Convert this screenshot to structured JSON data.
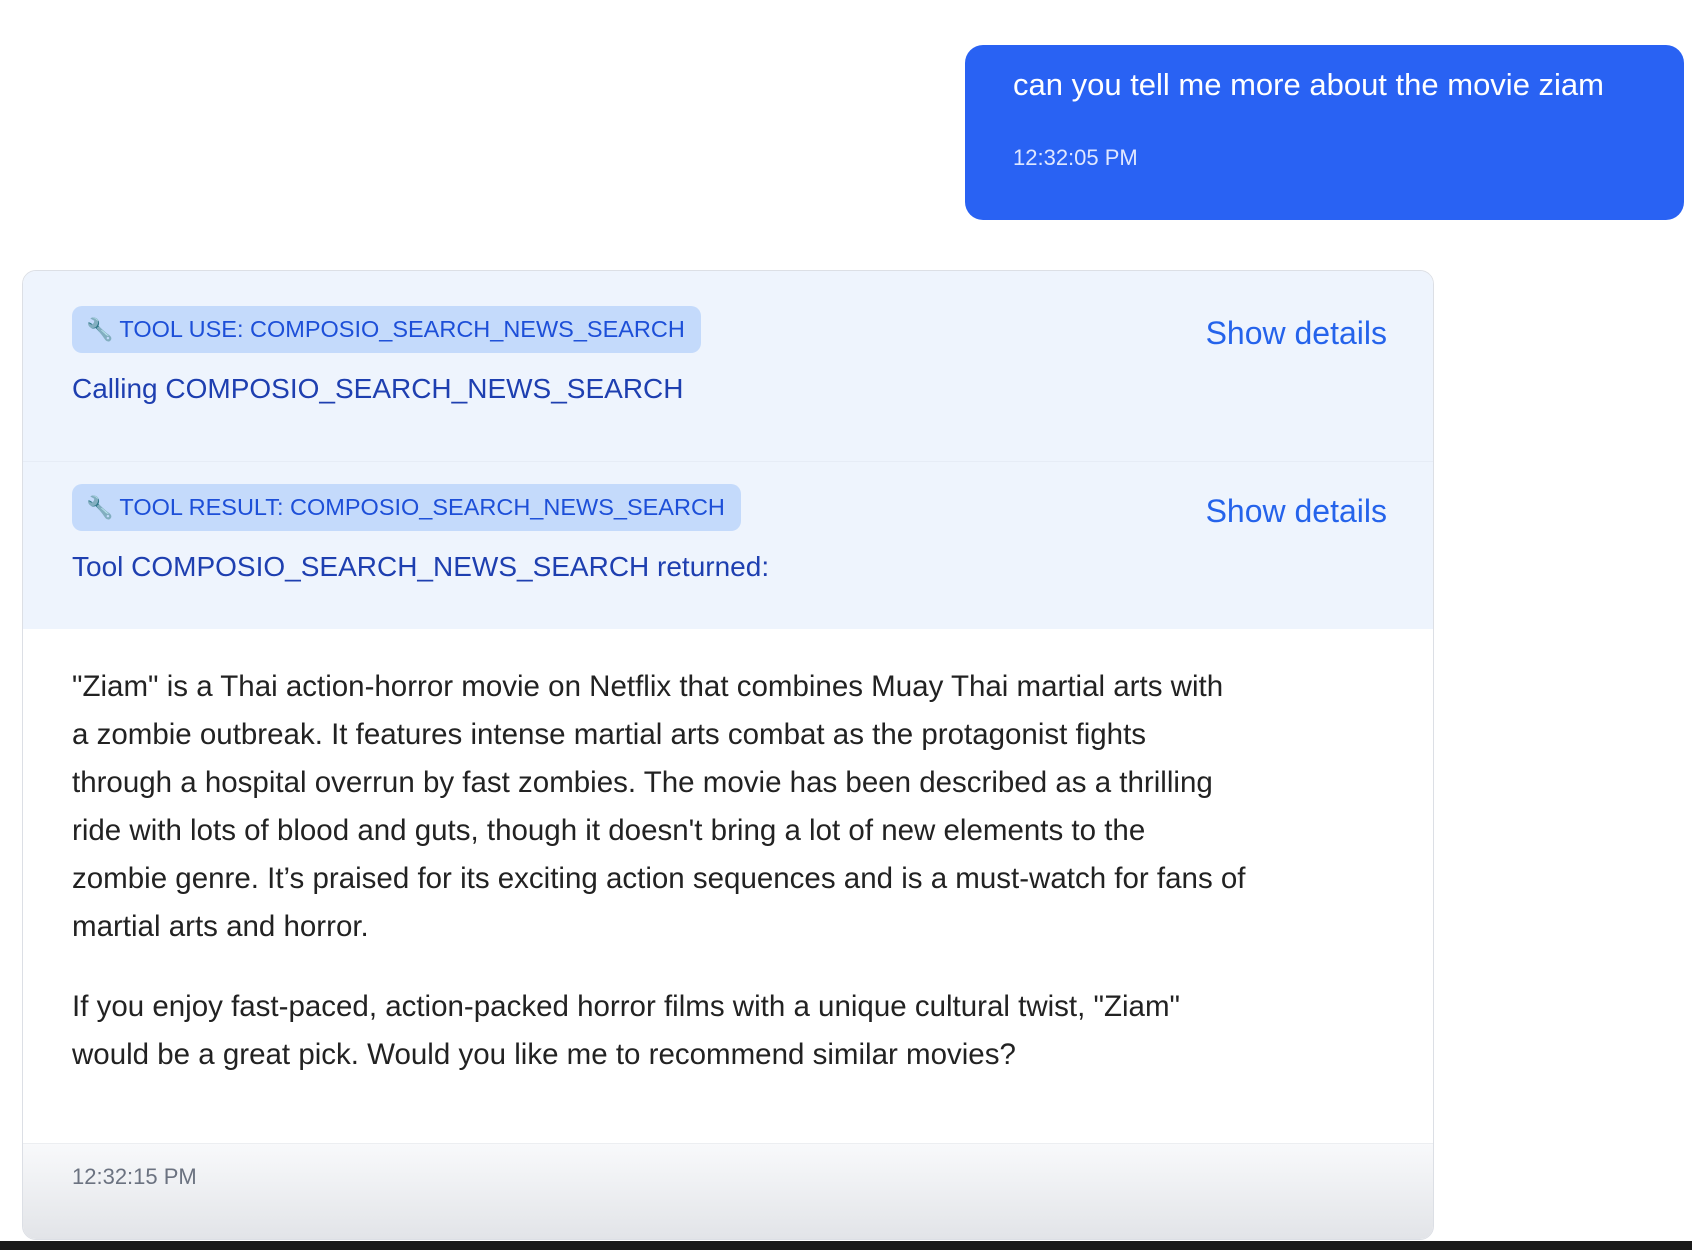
{
  "user_message": {
    "text": "can you tell me more about the movie ziam",
    "timestamp": "12:32:05 PM",
    "bubble_color": "#2962f3"
  },
  "assistant_message": {
    "tool_use": {
      "icon": "wrench-icon",
      "badge": "TOOL USE: COMPOSIO_SEARCH_NEWS_SEARCH",
      "text": "Calling COMPOSIO_SEARCH_NEWS_SEARCH",
      "toggle_label": "Show details"
    },
    "tool_result": {
      "icon": "wrench-icon",
      "badge": "TOOL RESULT: COMPOSIO_SEARCH_NEWS_SEARCH",
      "text": "Tool COMPOSIO_SEARCH_NEWS_SEARCH returned:",
      "toggle_label": "Show details"
    },
    "paragraphs": [
      [
        "\"Ziam\" is a Thai action-horror movie on Netflix that combines Muay Thai martial arts with",
        "a zombie outbreak. It features intense martial arts combat as the protagonist fights",
        "through a hospital overrun by fast zombies. The movie has been described as a thrilling",
        "ride with lots of blood and guts, though it doesn't bring a lot of new elements to the",
        "zombie genre. It’s praised for its exciting action sequences and is a must-watch for fans of",
        "martial arts and horror."
      ],
      [
        "If you enjoy fast-paced, action-packed horror films with a unique cultural twist, \"Ziam\"",
        "would be a great pick. Would you like me to recommend similar movies?"
      ]
    ],
    "timestamp": "12:32:15 PM"
  }
}
